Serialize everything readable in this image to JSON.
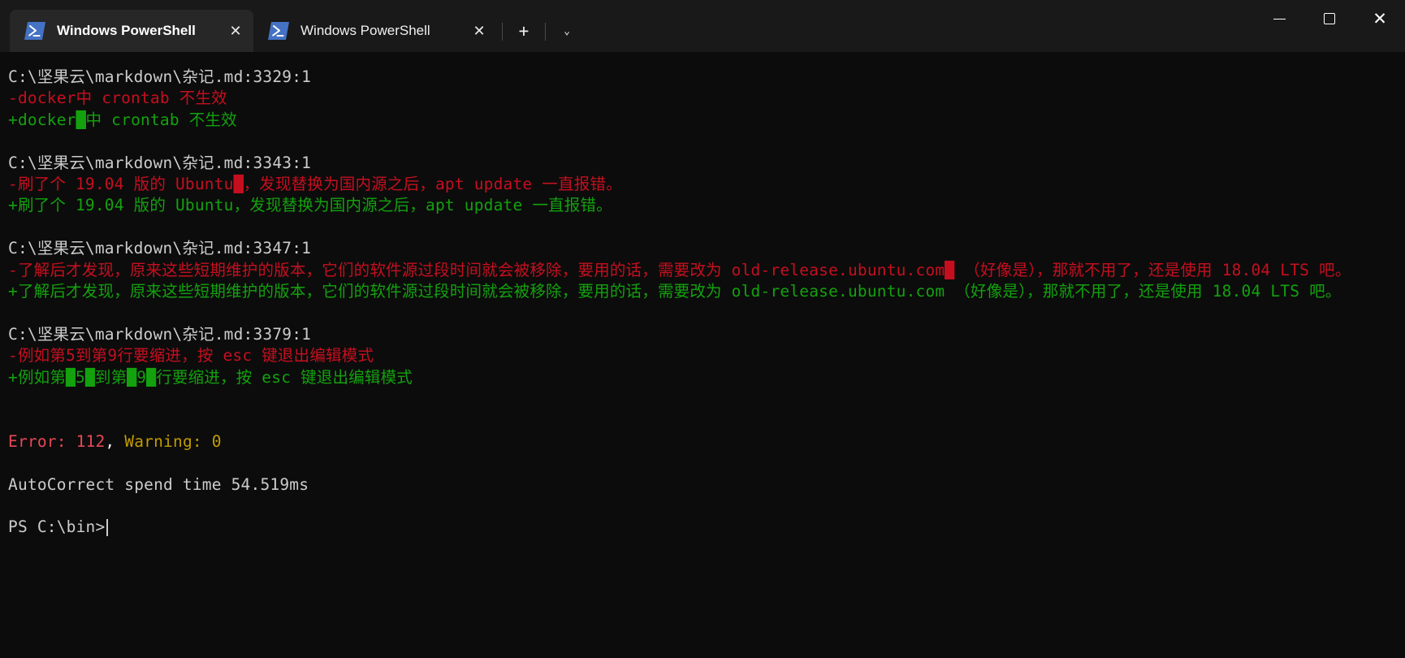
{
  "window": {
    "app_title": "Windows PowerShell",
    "controls": {
      "minimize": "minimize",
      "maximize": "maximize",
      "close": "close"
    }
  },
  "tabs": [
    {
      "title": "Windows PowerShell",
      "icon": "powershell-icon",
      "close_label": "✕",
      "active": true
    },
    {
      "title": "Windows PowerShell",
      "icon": "powershell-icon",
      "close_label": "✕",
      "active": false
    }
  ],
  "tabstrip": {
    "new_tab_label": "+",
    "dropdown_label": "⌄"
  },
  "terminal": {
    "blocks": [
      {
        "path": "C:\\坚果云\\markdown\\杂记.md:3329:1",
        "removed": [
          {
            "text": "-docker中 crontab 不生效"
          }
        ],
        "added": [
          {
            "pre": "+docker",
            "hl": "█",
            "post": "中 crontab 不生效"
          }
        ]
      },
      {
        "path": "C:\\坚果云\\markdown\\杂记.md:3343:1",
        "removed": [
          {
            "pre": "-刷了个 19.04 版的 Ubuntu",
            "hl": "█",
            "post": "，发现替换为国内源之后，apt update 一直报错。"
          }
        ],
        "added": [
          {
            "text": "+刷了个 19.04 版的 Ubuntu，发现替换为国内源之后，apt update 一直报错。"
          }
        ]
      },
      {
        "path": "C:\\坚果云\\markdown\\杂记.md:3347:1",
        "removed": [
          {
            "pre": "-了解后才发现，原来这些短期维护的版本，它们的软件源过段时间就会被移除，要用的话，需要改为 old-release.ubuntu.com",
            "hl": "█",
            "post": " （好像是），那就不用了，还是使用 18.04 LTS 吧。"
          }
        ],
        "added": [
          {
            "text": "+了解后才发现，原来这些短期维护的版本，它们的软件源过段时间就会被移除，要用的话，需要改为 old-release.ubuntu.com （好像是），那就不用了，还是使用 18.04 LTS 吧。"
          }
        ]
      },
      {
        "path": "C:\\坚果云\\markdown\\杂记.md:3379:1",
        "removed": [
          {
            "text": "-例如第5到第9行要缩进，按 esc 键退出编辑模式"
          }
        ],
        "added": [
          {
            "pre": "+例如第",
            "hl": "█",
            "mid1": "5",
            "hl2": "█",
            "mid2": "到第",
            "hl3": "█",
            "mid3": "9",
            "hl4": "█",
            "post": "行要缩进，按 esc 键退出编辑模式"
          }
        ]
      }
    ],
    "summary": {
      "error_label": "Error: 112",
      "comma": ",",
      "warning_label": " Warning: 0",
      "timing": "AutoCorrect spend time 54.519ms"
    },
    "prompt": {
      "text": "PS C:\\bin>"
    }
  }
}
